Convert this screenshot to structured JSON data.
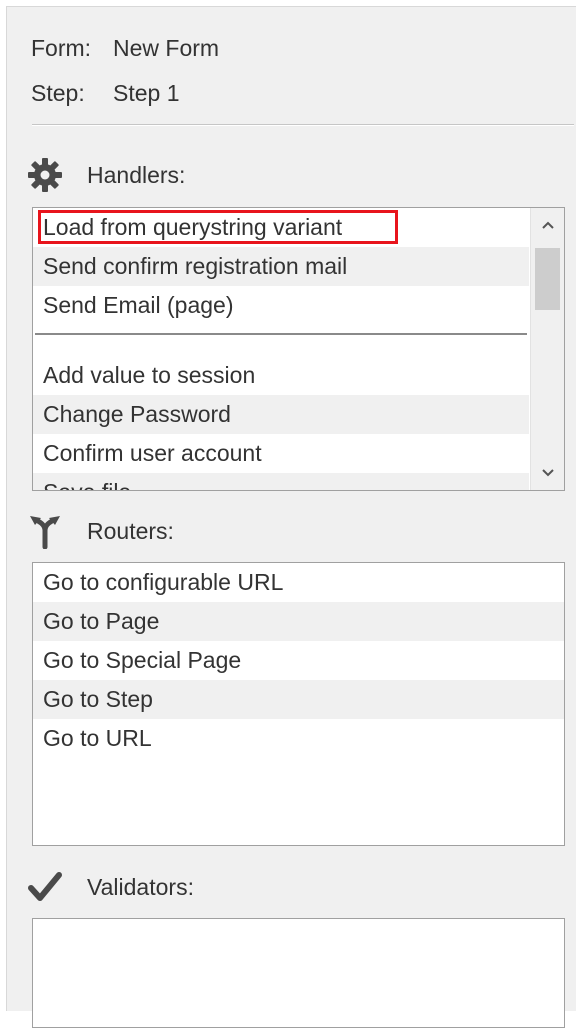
{
  "form": {
    "label": "Form:",
    "value": "New Form"
  },
  "step": {
    "label": "Step:",
    "value": "Step 1"
  },
  "handlers": {
    "title": "Handlers:",
    "selected_items": [
      "Load from querystring variant",
      "Send confirm registration mail",
      "Send Email (page)"
    ],
    "available_items": [
      "Add value to session",
      "Change Password",
      "Confirm user account",
      "Save file"
    ],
    "scrollbar": {
      "up_glyph": "⌃",
      "down_glyph": "⌄"
    }
  },
  "routers": {
    "title": "Routers:",
    "items": [
      "Go to configurable URL",
      "Go to Page",
      "Go to Special Page",
      "Go to Step",
      "Go to URL"
    ]
  },
  "validators": {
    "title": "Validators:",
    "items": []
  },
  "icons": {
    "handlers": "gear-icon",
    "routers": "fork-icon",
    "validators": "checkmark-icon"
  },
  "colors": {
    "highlight_border": "#e8141c",
    "alt_row": "#f0f0f0",
    "panel_bg": "#f0f0f0"
  }
}
